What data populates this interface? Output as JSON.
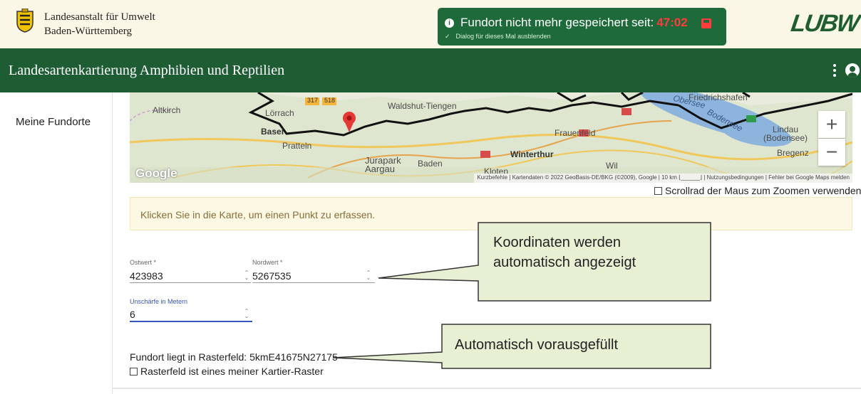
{
  "header": {
    "org_line1": "Landesanstalt für Umwelt",
    "org_line2": "Baden-Württemberg",
    "logo_text": "LUBW"
  },
  "toast": {
    "message": "Fundort nicht mehr gespeichert seit:",
    "time": "47:02",
    "hide_label": "Dialog für dieses Mal ausblenden",
    "check_glyph": "✓",
    "info_glyph": "i"
  },
  "appbar": {
    "title": "Landesartenkartierung Amphibien und Reptilien"
  },
  "sidebar": {
    "items": [
      {
        "label": "Meine Fundorte"
      }
    ]
  },
  "map": {
    "labels": {
      "altkirch": "Altkirch",
      "loerrach": "Lörrach",
      "basel": "Basel",
      "pratteln": "Pratteln",
      "waldshut": "Waldshut-Tiengen",
      "frauenfeld": "Frauenfeld",
      "winterthur": "Winterthur",
      "jurapark": "Jurapark Aargau",
      "baden": "Baden",
      "kloten": "Kloten",
      "wil": "Wil",
      "friedrichshafen": "Friedrichshafen",
      "obersee": "Obersee",
      "bodensee": "Bodensee",
      "lindau": "Lindau (Bodensee)",
      "bregenz": "Bregenz",
      "road_317": "317",
      "road_518": "518"
    },
    "google_logo": "Google",
    "attribution": "Kurzbefehle | Kartendaten © 2022 GeoBasis-DE/BKG (©2009), Google | 10 km ⌊______⌋ | Nutzungsbedingungen | Fehler bei Google Maps melden",
    "zoom_in": "+",
    "zoom_out": "−"
  },
  "scroll_zoom_label": "Scrollrad der Maus zum Zoomen verwenden",
  "hint": "Klicken Sie in die Karte, um einen Punkt zu erfassen.",
  "fields": {
    "ostwert": {
      "label": "Ostwert *",
      "value": "423983"
    },
    "nordwert": {
      "label": "Nordwert *",
      "value": "5267535"
    },
    "unschaerfe": {
      "label": "Unschärfe in Metern",
      "value": "6"
    }
  },
  "raster": {
    "text": "Fundort liegt in Rasterfeld: 5kmE41675N27175",
    "checkbox_label": "Rasterfeld ist eines meiner Kartier-Raster"
  },
  "callouts": {
    "koordinaten_line1": "Koordinaten werden",
    "koordinaten_line2": "automatisch angezeigt",
    "automatisch": "Automatisch vorausgefüllt"
  },
  "colors": {
    "appbar": "#1e5c34",
    "toast": "#1e6a3a",
    "timer": "#ff3b3b",
    "callout_fill": "#e8f0d4",
    "field_active": "#3a53c4"
  }
}
